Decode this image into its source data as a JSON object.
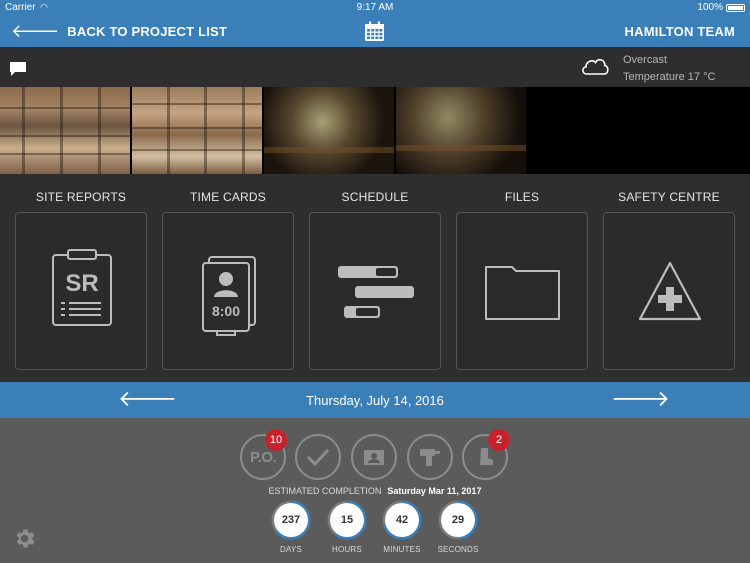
{
  "status_bar": {
    "carrier": "Carrier",
    "time": "9:17 AM",
    "battery": "100%"
  },
  "nav": {
    "back_label": "BACK TO PROJECT LIST",
    "team": "HAMILTON TEAM"
  },
  "weather": {
    "condition": "Overcast",
    "temperature": "Temperature 17 °C"
  },
  "photos": [
    "construction-site-photo-1",
    "construction-site-photo-2",
    "equipment-photo-1",
    "equipment-photo-2"
  ],
  "modules": [
    {
      "title": "SITE REPORTS",
      "icon": "site-report-icon",
      "icon_text": "SR"
    },
    {
      "title": "TIME CARDS",
      "icon": "time-card-icon",
      "icon_text": "8:00"
    },
    {
      "title": "SCHEDULE",
      "icon": "schedule-icon"
    },
    {
      "title": "FILES",
      "icon": "folder-icon"
    },
    {
      "title": "SAFETY CENTRE",
      "icon": "safety-icon"
    }
  ],
  "date_bar": {
    "date": "Thursday, July 14, 2016"
  },
  "status_icons": [
    {
      "label": "P.O.",
      "badge": "10"
    },
    {
      "icon": "checkmark-icon"
    },
    {
      "icon": "id-card-icon"
    },
    {
      "icon": "drill-icon"
    },
    {
      "icon": "boot-icon",
      "badge": "2"
    }
  ],
  "completion": {
    "label": "ESTIMATED COMPLETION",
    "date": "Saturday Mar 11, 2017"
  },
  "countdown": [
    {
      "value": "237",
      "label": "DAYS",
      "fraction": 0.65
    },
    {
      "value": "15",
      "label": "HOURS",
      "fraction": 0.62
    },
    {
      "value": "42",
      "label": "MINUTES",
      "fraction": 0.7
    },
    {
      "value": "29",
      "label": "SECONDS",
      "fraction": 0.48
    }
  ],
  "colors": {
    "accent": "#3a7fb8",
    "panel": "#2e2e2e",
    "bottom": "#5b5b5b",
    "badge": "#c7222c"
  }
}
